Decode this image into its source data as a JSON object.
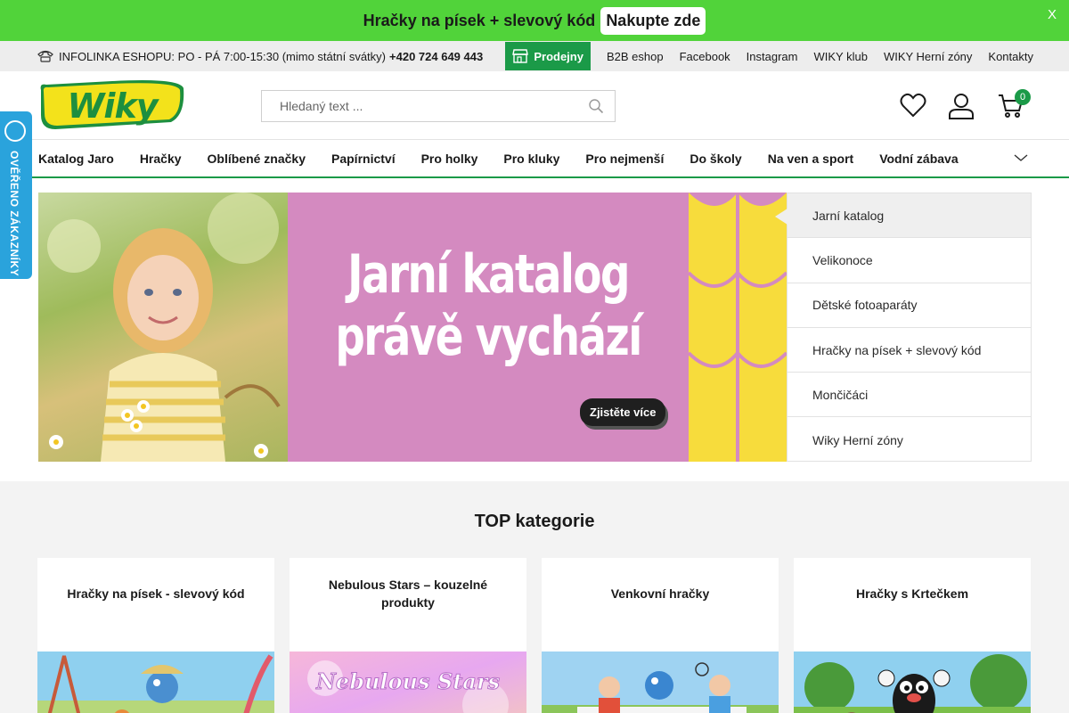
{
  "promo": {
    "text": "Hračky na písek + slevový kód",
    "button": "Nakupte zde",
    "close": "X"
  },
  "infobar": {
    "label": "INFOLINKA ESHOPU: PO - PÁ 7:00-15:30 (mimo státní svátky)",
    "phone": "+420 724 649 443",
    "links": [
      "Prodejny",
      "B2B eshop",
      "Facebook",
      "Instagram",
      "WIKY klub",
      "WIKY Herní zóny",
      "Kontakty"
    ]
  },
  "header": {
    "logo_text": "Wiky",
    "search_placeholder": "Hledaný text ...",
    "cart_count": "0"
  },
  "mainnav": {
    "items": [
      "Katalog Jaro",
      "Hračky",
      "Oblíbené značky",
      "Papírnictví",
      "Pro holky",
      "Pro kluky",
      "Pro nejmenší",
      "Do školy",
      "Na ven a sport",
      "Vodní zábava"
    ]
  },
  "hero": {
    "line1": "Jarní katalog",
    "line2": "právě vychází",
    "cta": "Zjistěte více"
  },
  "sidelist": {
    "items": [
      "Jarní katalog",
      "Velikonoce",
      "Dětské fotoaparáty",
      "Hračky na písek + slevový kód",
      "Mončičáci",
      "Wiky Herní zóny"
    ]
  },
  "topcat": {
    "title": "TOP kategorie",
    "cards": [
      "Hračky na písek - slevový kód",
      "Nebulous Stars – kouzelné produkty",
      "Venkovní hračky",
      "Hračky s Krtečkem"
    ],
    "nebulous_logo": "Nebulous Stars"
  },
  "verified": {
    "text": "OVĚŘENO ZÁKAZNÍKY"
  },
  "colors": {
    "promo_green": "#51d33a",
    "brand_green": "#1b9a48",
    "hero_pink": "#d48ac0",
    "hero_yellow": "#f7dc3c",
    "verified_blue": "#2aa3dc"
  }
}
